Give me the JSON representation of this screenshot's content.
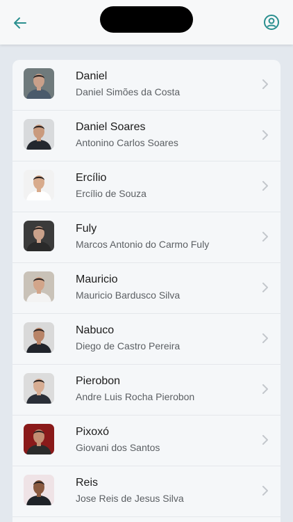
{
  "header": {
    "back_icon": "arrow-left-icon",
    "account_icon": "user-circle-icon",
    "accent": "#2a8f8f"
  },
  "contacts": [
    {
      "name": "Daniel",
      "full_name": "Daniel Simões da Costa",
      "bg": "#6f7a7c",
      "skin": "#c9a08a",
      "shirt": "#4a5a6b"
    },
    {
      "name": "Daniel Soares",
      "full_name": "Antonino Carlos Soares",
      "bg": "#d8dadc",
      "skin": "#c99a7d",
      "shirt": "#23272e"
    },
    {
      "name": "Ercílio",
      "full_name": "Ercílio de Souza",
      "bg": "#f2f2f2",
      "skin": "#d8ab8c",
      "shirt": "#ffffff"
    },
    {
      "name": "Fuly",
      "full_name": "Marcos Antonio do Carmo Fuly",
      "bg": "#3b3b3b",
      "skin": "#caa18a",
      "shirt": "#2a2a2a"
    },
    {
      "name": "Mauricio",
      "full_name": "Mauricio Bardusco Silva",
      "bg": "#c9c2b8",
      "skin": "#d2a58a",
      "shirt": "#f3f3f3"
    },
    {
      "name": "Nabuco",
      "full_name": "Diego de Castro Pereira",
      "bg": "#d9d9d9",
      "skin": "#b88468",
      "shirt": "#20242b"
    },
    {
      "name": "Pierobon",
      "full_name": "Andre Luis Rocha Pierobon",
      "bg": "#dcdcdc",
      "skin": "#d7ad93",
      "shirt": "#2a2f38"
    },
    {
      "name": "Pixoxó",
      "full_name": "Giovani dos Santos",
      "bg": "#8a1a1a",
      "skin": "#c38f73",
      "shirt": "#2b2b2b"
    },
    {
      "name": "Reis",
      "full_name": "Jose Reis de Jesus Silva",
      "bg": "#efe3e6",
      "skin": "#8a5a40",
      "shirt": "#1f2328"
    }
  ]
}
